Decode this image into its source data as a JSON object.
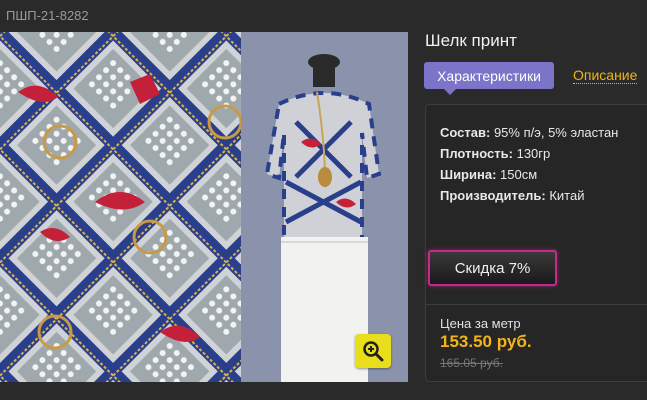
{
  "product": {
    "sku": "ПШП-21-8282",
    "title": "Шелк принт"
  },
  "tabs": {
    "active": "Характеристики",
    "other": "Описание"
  },
  "specs": [
    {
      "label": "Состав:",
      "value": "95% п/э, 5% эластан"
    },
    {
      "label": "Плотность:",
      "value": "130гр"
    },
    {
      "label": "Ширина:",
      "value": "150см"
    },
    {
      "label": "Производитель:",
      "value": "Китай"
    }
  ],
  "discount": "Скидка 7%",
  "pricing": {
    "label": "Цена за метр",
    "price": "153.50 руб.",
    "old_price": "165.05 руб."
  },
  "icons": {
    "zoom": "zoom-in-icon"
  },
  "colors": {
    "accent": "#7b74c8",
    "price": "#f2b417",
    "discount_border": "#c9268e",
    "zoom_button": "#e8de1a"
  }
}
